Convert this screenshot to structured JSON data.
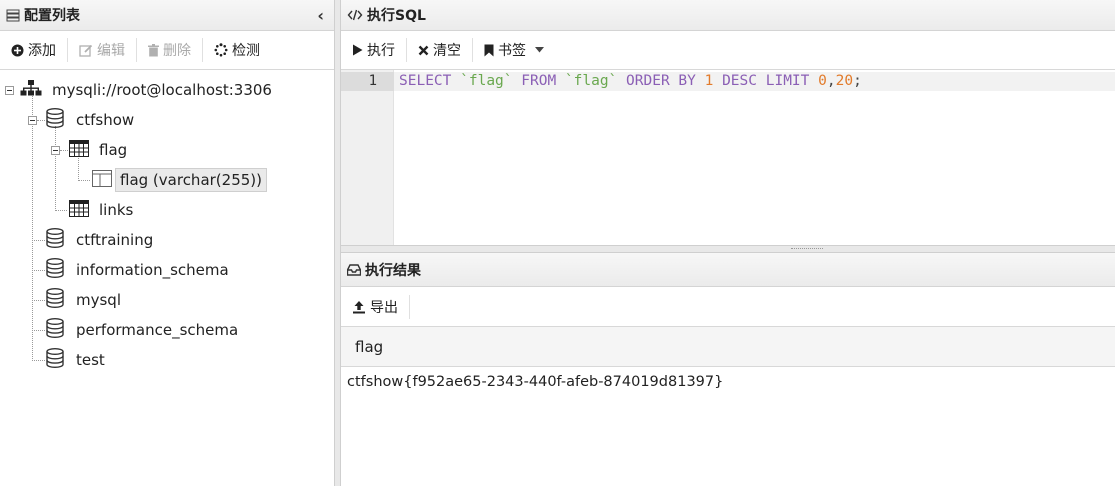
{
  "left_panel": {
    "title": "配置列表",
    "collapse_glyph": "‹",
    "toolbar": {
      "add": "添加",
      "edit": "编辑",
      "delete": "删除",
      "test": "检测"
    },
    "tree": {
      "connection": "mysqli://root@localhost:3306",
      "db_ctfshow": "ctfshow",
      "table_flag": "flag",
      "column_flag": "flag (varchar(255))",
      "table_links": "links",
      "db_ctftraining": "ctftraining",
      "db_information_schema": "information_schema",
      "db_mysql": "mysql",
      "db_performance_schema": "performance_schema",
      "db_test": "test"
    }
  },
  "sql_panel": {
    "title": "执行SQL",
    "toolbar": {
      "execute": "执行",
      "clear": "清空",
      "bookmark": "书签"
    },
    "line_number": "1",
    "query": {
      "select": "SELECT",
      "field": "`flag`",
      "from": "FROM",
      "table": "`flag`",
      "order_by": "ORDER BY",
      "order_col": "1",
      "desc": "DESC",
      "limit": "LIMIT",
      "offset": "0",
      "comma": ",",
      "count": "20",
      "semicolon": ";"
    }
  },
  "results_panel": {
    "title": "执行结果",
    "toolbar": {
      "export": "导出"
    },
    "columns": [
      "flag"
    ],
    "rows": [
      [
        "ctfshow{f952ae65-2343-440f-afeb-874019d81397}"
      ]
    ]
  },
  "colors": {
    "keyword": "#8b5fb5",
    "identifier": "#6aa84f",
    "number": "#e27b2b"
  }
}
